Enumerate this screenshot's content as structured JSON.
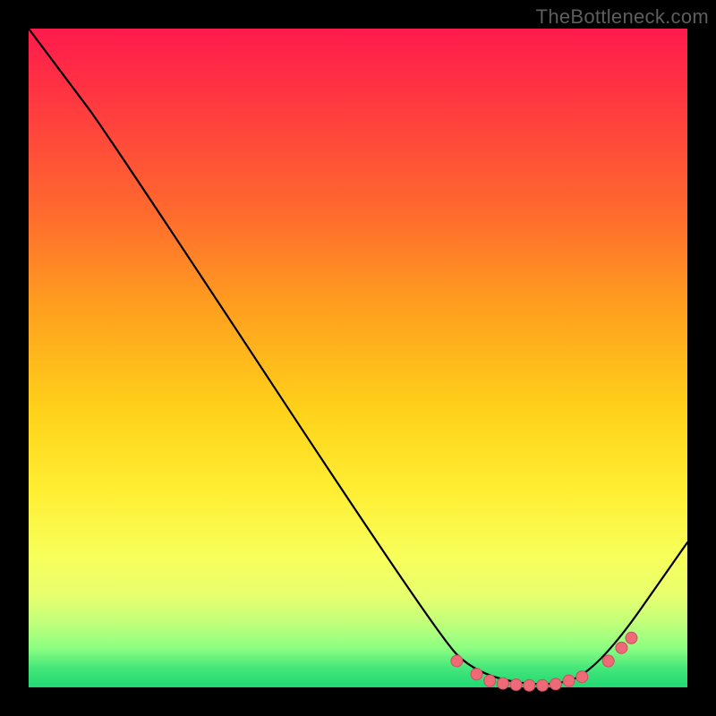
{
  "watermark": "TheBottleneck.com",
  "colors": {
    "curve_stroke": "#000000",
    "marker_fill": "#ed6a76",
    "marker_stroke": "#c95060"
  },
  "chart_data": {
    "type": "line",
    "title": "",
    "xlabel": "",
    "ylabel": "",
    "xlim": [
      0,
      100
    ],
    "ylim": [
      0,
      100
    ],
    "curve": [
      {
        "x": 0,
        "y": 100
      },
      {
        "x": 6,
        "y": 92
      },
      {
        "x": 12,
        "y": 84
      },
      {
        "x": 62,
        "y": 8
      },
      {
        "x": 68,
        "y": 2
      },
      {
        "x": 78,
        "y": 0
      },
      {
        "x": 86,
        "y": 2
      },
      {
        "x": 100,
        "y": 22
      }
    ],
    "markers": [
      {
        "x": 65,
        "y": 4
      },
      {
        "x": 68,
        "y": 2
      },
      {
        "x": 70,
        "y": 1
      },
      {
        "x": 72,
        "y": 0.6
      },
      {
        "x": 74,
        "y": 0.4
      },
      {
        "x": 76,
        "y": 0.3
      },
      {
        "x": 78,
        "y": 0.3
      },
      {
        "x": 80,
        "y": 0.5
      },
      {
        "x": 82,
        "y": 1
      },
      {
        "x": 84,
        "y": 1.6
      },
      {
        "x": 88,
        "y": 4
      },
      {
        "x": 90,
        "y": 6
      },
      {
        "x": 91.5,
        "y": 7.5
      }
    ]
  }
}
